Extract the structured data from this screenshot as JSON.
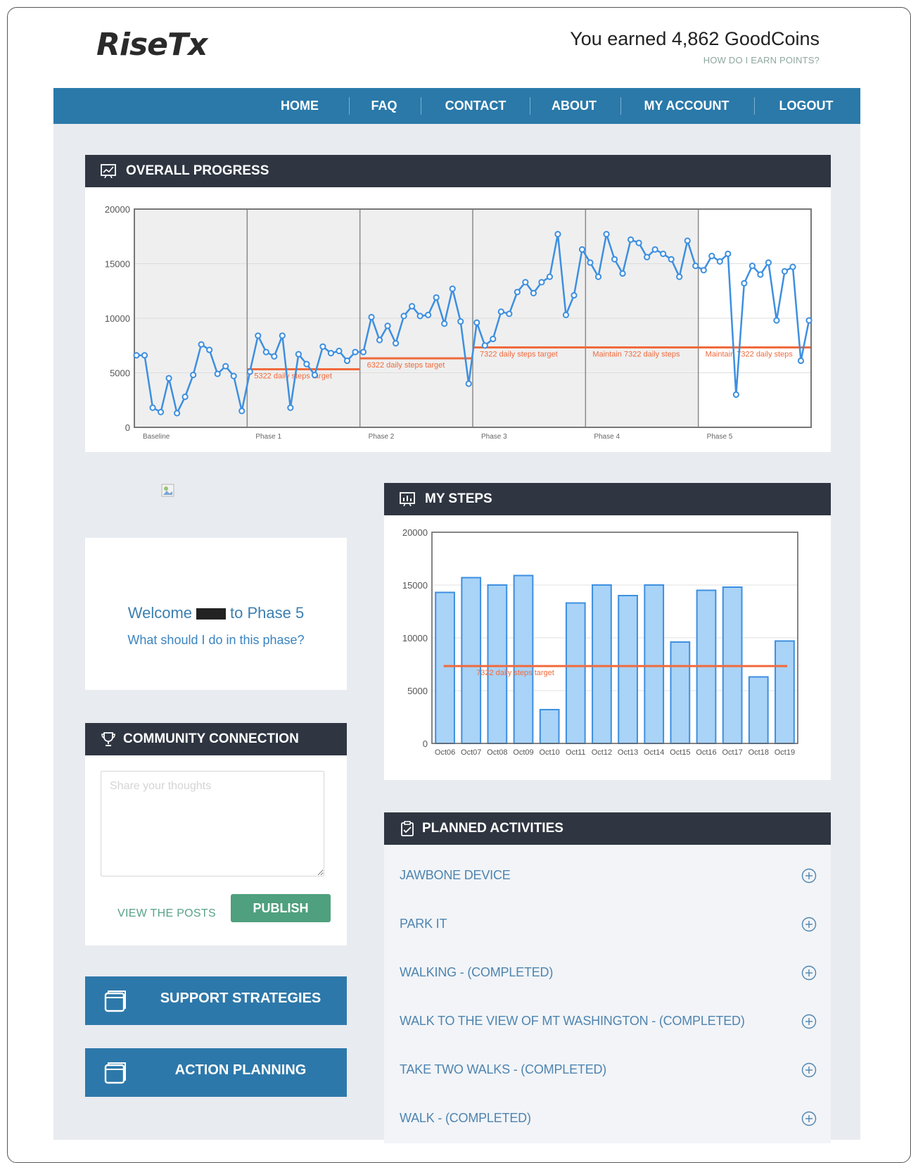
{
  "header": {
    "logo": "RiseTx",
    "earned_text": "You earned 4,862 GoodCoins",
    "earn_link": "HOW DO I EARN POINTS?"
  },
  "nav": {
    "items": [
      "HOME",
      "FAQ",
      "CONTACT",
      "ABOUT",
      "MY ACCOUNT",
      "LOGOUT"
    ]
  },
  "overall_progress": {
    "title": "OVERALL PROGRESS"
  },
  "my_steps": {
    "title": "MY STEPS"
  },
  "welcome": {
    "text_before": "Welcome",
    "text_after": "to Phase 5",
    "link": "What should I do in this phase?"
  },
  "community": {
    "title": "COMMUNITY CONNECTION",
    "placeholder": "Share your thoughts",
    "view_posts": "VIEW THE POSTS",
    "publish": "PUBLISH"
  },
  "buttons": {
    "support": "SUPPORT STRATEGIES",
    "action": "ACTION PLANNING"
  },
  "planned": {
    "title": "PLANNED ACTIVITIES",
    "items": [
      "JAWBONE DEVICE",
      "PARK IT",
      "WALKING - (COMPLETED)",
      "WALK TO THE VIEW OF MT WASHINGTON - (COMPLETED)",
      "TAKE TWO WALKS - (COMPLETED)",
      "WALK - (COMPLETED)"
    ]
  },
  "colors": {
    "nav": "#2a79a9",
    "panel_head": "#2f3642",
    "line": "#3d8fe0",
    "target": "#f06a3c",
    "publish": "#4fa07e"
  },
  "chart_data": [
    {
      "type": "line",
      "ylim": [
        0,
        20000
      ],
      "yticks": [
        0,
        5000,
        10000,
        15000,
        20000
      ],
      "phases": [
        "Baseline",
        "Phase 1",
        "Phase 2",
        "Phase 3",
        "Phase 4",
        "Phase 5"
      ],
      "targets": [
        {
          "phase": 1,
          "value": 5322,
          "label": "5322 daily steps target"
        },
        {
          "phase": 2,
          "value": 6322,
          "label": "6322 daily steps target"
        },
        {
          "phase": 3,
          "value": 7322,
          "label": "7322 daily steps target"
        },
        {
          "phase": 4,
          "value": 7322,
          "label": "Maintain 7322 daily steps"
        },
        {
          "phase": 5,
          "value": 7322,
          "label": "Maintain 7322 daily steps"
        }
      ],
      "series": [
        {
          "values": [
            6600,
            6600,
            1800,
            1400,
            4500,
            1300,
            2800,
            4800,
            7600,
            7100,
            4900,
            5600,
            4700,
            1500,
            5100,
            8400,
            6900,
            6500,
            8400,
            1800,
            6700,
            5800,
            4800,
            7400,
            6800,
            7000,
            6100,
            6900,
            6900,
            10100,
            8000,
            9300,
            7700,
            10200,
            11100,
            10200,
            10300,
            11900,
            9500,
            12700,
            9700,
            4000,
            9600,
            7500,
            8100,
            10600,
            10400,
            12400,
            13300,
            12300,
            13300,
            13800,
            17700,
            10300,
            12100,
            16300,
            15100,
            13800,
            17700,
            15400,
            14100,
            17200,
            16900,
            15600,
            16300,
            15900,
            15400,
            13800,
            17100,
            14800,
            14400,
            15700,
            15200,
            15900,
            3000,
            13200,
            14800,
            14000,
            15100,
            9800,
            14300,
            14700,
            6100,
            9800
          ]
        }
      ]
    },
    {
      "type": "bar",
      "ylim": [
        0,
        20000
      ],
      "yticks": [
        0,
        5000,
        10000,
        15000,
        20000
      ],
      "categories": [
        "Oct06",
        "Oct07",
        "Oct08",
        "Oct09",
        "Oct10",
        "Oct11",
        "Oct12",
        "Oct13",
        "Oct14",
        "Oct15",
        "Oct16",
        "Oct17",
        "Oct18",
        "Oct19"
      ],
      "values": [
        14300,
        15700,
        15000,
        15900,
        3200,
        13300,
        15000,
        14000,
        15000,
        9600,
        14500,
        14800,
        6300,
        9700
      ],
      "target": {
        "value": 7322,
        "label": "7322 daily steps target"
      }
    }
  ]
}
